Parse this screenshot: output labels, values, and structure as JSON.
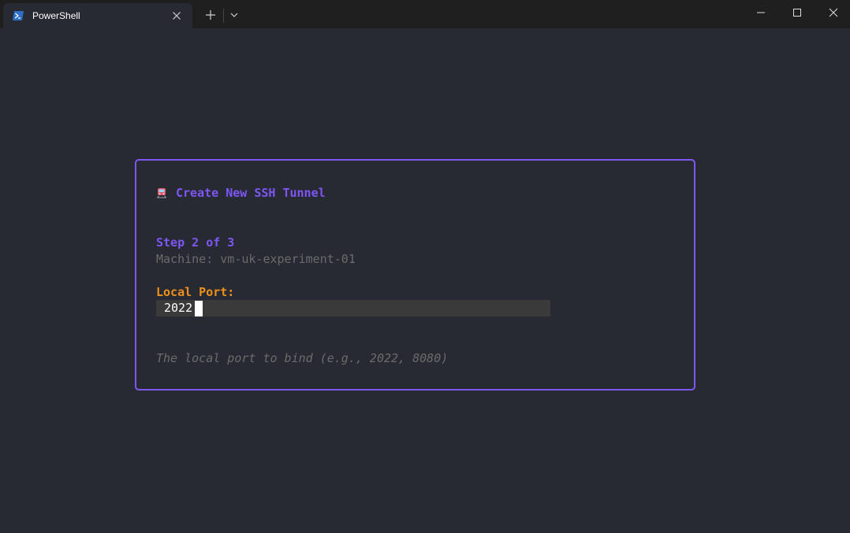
{
  "tabbar": {
    "tab_title": "PowerShell",
    "tab_icon": "powershell-icon",
    "close_icon": "close-icon",
    "new_tab_icon": "plus-icon",
    "dropdown_icon": "chevron-down-icon"
  },
  "window_controls": {
    "minimize_icon": "minimize-icon",
    "maximize_icon": "maximize-icon",
    "close_icon": "close-icon"
  },
  "dialog": {
    "icon": "train-icon",
    "title": "Create New SSH Tunnel",
    "step": "Step 2 of 3",
    "machine": "Machine: vm-uk-experiment-01",
    "field_label": "Local Port:",
    "field_value": "2022",
    "hint": "The local port to bind (e.g., 2022, 8080)"
  },
  "colors": {
    "background": "#272a33",
    "titlebar": "#1f1f1f",
    "accent": "#7d56f4",
    "label": "#f0901c",
    "muted": "#6b6b6b",
    "input_bg": "#3a3a3a"
  }
}
